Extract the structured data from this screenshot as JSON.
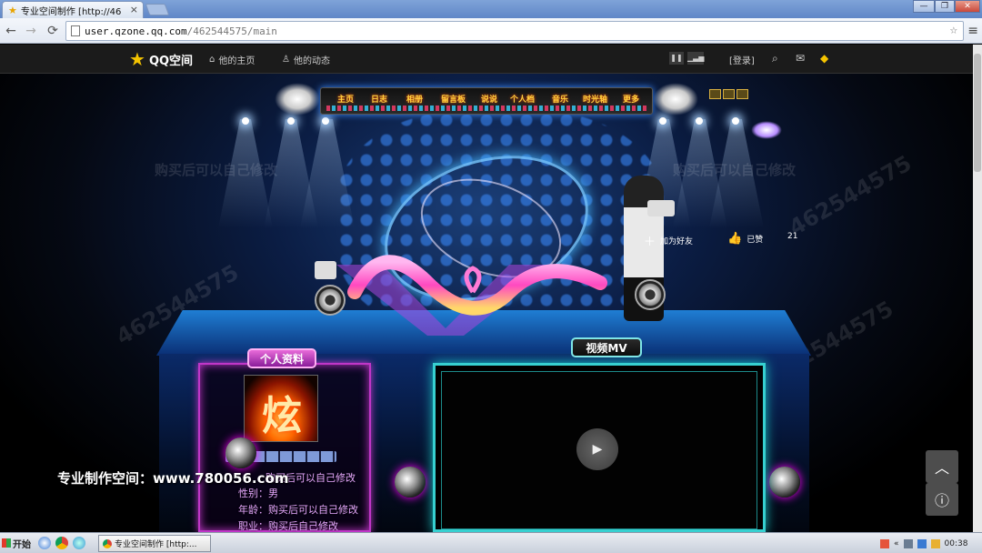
{
  "browser": {
    "tab": {
      "title": "专业空间制作 [http://46",
      "close": "×"
    },
    "window_controls": [
      "—",
      "❐",
      "✕"
    ],
    "nav": {
      "back": "←",
      "forward": "→",
      "reload": "⟳"
    },
    "url_host": "user.qzone.qq.com",
    "url_path": "/462544575/main",
    "bookmark_icon": "star-outline-icon",
    "menu_icon": "wrench-menu-icon"
  },
  "qzone": {
    "logo_text": "QQ空间",
    "nav": [
      {
        "label": "他的主页",
        "icon": "home-icon"
      },
      {
        "label": "他的动态",
        "icon": "user-icon"
      }
    ],
    "login_label": "[登录]",
    "icons": [
      "search-icon",
      "mail-icon",
      "diamond-icon"
    ]
  },
  "stage": {
    "menu_items": [
      "主页",
      "日志",
      "相册",
      "留言板",
      "说说",
      "个人档",
      "音乐",
      "时光轴",
      "更多"
    ],
    "add_friend": "加为好友",
    "like_label": "已赞",
    "like_count": "21",
    "watermark": "462544575",
    "watermark_text": "购买后可以自己修改"
  },
  "profile_panel": {
    "label": "个人资料",
    "lines": [
      "购买后可以自己修改",
      "性别：男",
      "年龄：购买后可以自己修改",
      "职业：购买后自己修改"
    ]
  },
  "video_panel": {
    "label": "视频MV"
  },
  "overlay_text": "专业制作空间：www.780056.com",
  "side_buttons": [
    "chevron-up-icon",
    "info-icon"
  ],
  "taskbar": {
    "start_label": "开始",
    "task_label": "专业空间制作 [http:...",
    "clock": "00:38"
  },
  "colors": {
    "accent_blue": "#1f7ed4",
    "profile_border": "#c036c8",
    "video_border": "#36d0d0",
    "menu_text": "#ffd23e"
  }
}
